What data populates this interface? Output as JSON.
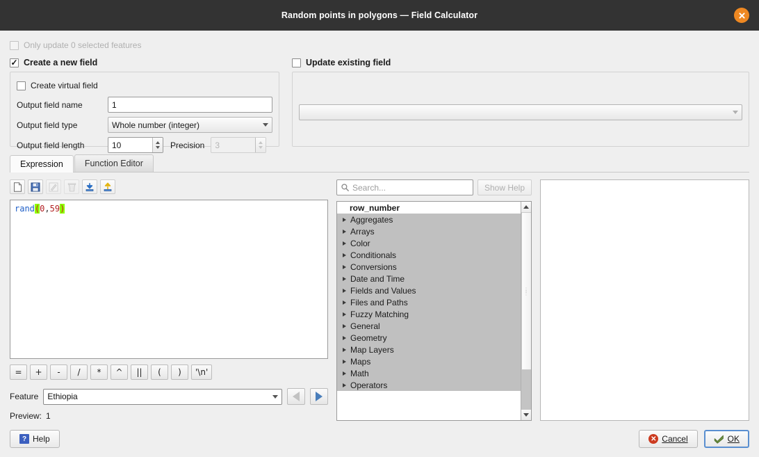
{
  "window": {
    "title": "Random points in polygons — Field Calculator",
    "close_icon": "close-circle-icon"
  },
  "options": {
    "only_update_selected": "Only update 0 selected features",
    "create_new_field": "Create a new field",
    "update_existing_field": "Update existing field"
  },
  "new_field": {
    "create_virtual_field": "Create virtual field",
    "output_field_name_label": "Output field name",
    "output_field_name_value": "1",
    "output_field_type_label": "Output field type",
    "output_field_type_value": "Whole number (integer)",
    "output_field_length_label": "Output field length",
    "output_field_length_value": "10",
    "precision_label": "Precision",
    "precision_value": "3"
  },
  "existing_field": {
    "combo_value": ""
  },
  "tabs": [
    {
      "label": "Expression",
      "active": true
    },
    {
      "label": "Function Editor",
      "active": false
    }
  ],
  "expression_toolbar": [
    {
      "name": "new-file-icon",
      "enabled": true
    },
    {
      "name": "save-icon",
      "enabled": true
    },
    {
      "name": "edit-pencil-icon",
      "enabled": false
    },
    {
      "name": "delete-trash-icon",
      "enabled": false
    },
    {
      "name": "import-download-icon",
      "enabled": true
    },
    {
      "name": "export-upload-icon",
      "enabled": true
    }
  ],
  "expression": {
    "function": "rand",
    "open_paren": "(",
    "arg1": "0",
    "comma": ",",
    "arg2": "59",
    "close_paren": ")",
    "full_text": "rand(0,59)"
  },
  "operator_buttons": [
    "=",
    "+",
    "-",
    "/",
    "*",
    "^",
    "||",
    "(",
    ")",
    "'\\n'"
  ],
  "feature": {
    "label": "Feature",
    "value": "Ethiopia",
    "prev_enabled": false,
    "next_enabled": true
  },
  "preview": {
    "label": "Preview:",
    "value": "1"
  },
  "functions_panel": {
    "search_placeholder": "Search...",
    "search_value": "",
    "show_help_label": "Show Help",
    "items": [
      {
        "label": "row_number",
        "type": "header"
      },
      {
        "label": "Aggregates",
        "type": "group"
      },
      {
        "label": "Arrays",
        "type": "group"
      },
      {
        "label": "Color",
        "type": "group"
      },
      {
        "label": "Conditionals",
        "type": "group"
      },
      {
        "label": "Conversions",
        "type": "group"
      },
      {
        "label": "Date and Time",
        "type": "group"
      },
      {
        "label": "Fields and Values",
        "type": "group"
      },
      {
        "label": "Files and Paths",
        "type": "group"
      },
      {
        "label": "Fuzzy Matching",
        "type": "group"
      },
      {
        "label": "General",
        "type": "group"
      },
      {
        "label": "Geometry",
        "type": "group"
      },
      {
        "label": "Map Layers",
        "type": "group"
      },
      {
        "label": "Maps",
        "type": "group"
      },
      {
        "label": "Math",
        "type": "group"
      },
      {
        "label": "Operators",
        "type": "group"
      }
    ]
  },
  "help_panel": {
    "content": ""
  },
  "footer": {
    "help_label": "Help",
    "cancel_label": "Cancel",
    "ok_label": "OK"
  },
  "colors": {
    "titlebar_bg": "#333333",
    "close_button": "#ee8822",
    "dialog_bg": "#efefef",
    "expression_function": "#2060c8",
    "expression_highlight": "#8dff00",
    "expression_number": "#b22222",
    "focus_border": "#5a8fd0"
  }
}
